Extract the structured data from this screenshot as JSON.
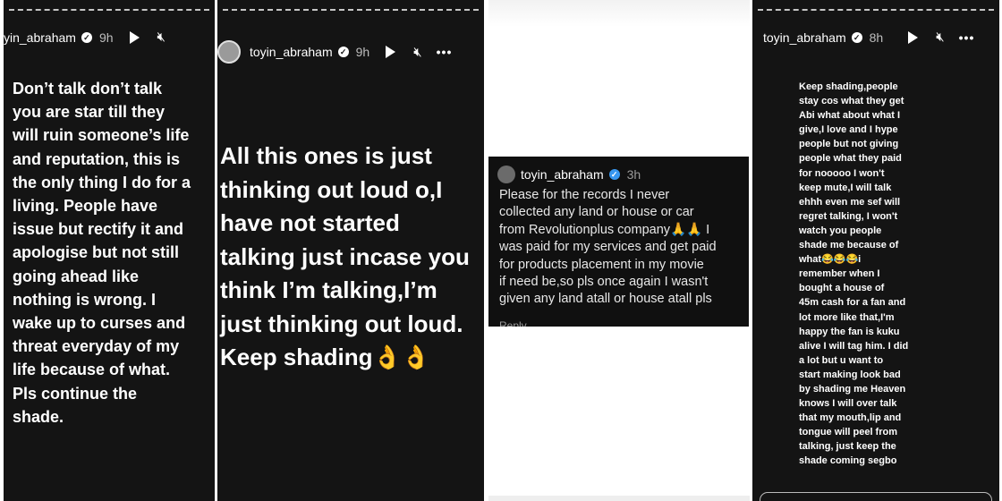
{
  "panels": [
    {
      "username": "yin_abraham",
      "time": "9h",
      "story_text": "Don’t talk don’t talk\nyou are star till they\nwill ruin someone’s life\nand reputation, this is\nthe only thing I do for a\nliving. People have\nissue but rectify it and\napologise but not still\ngoing ahead like\nnothing is wrong. I\nwake up to curses and\nthreat everyday of my\nlife because of what.\nPls continue the\nshade."
    },
    {
      "username": "toyin_abraham",
      "time": "9h",
      "story_text": "All this ones is just\nthinking out loud o,I\nhave not started\ntalking just incase you\nthink I’m talking,I’m\njust thinking out loud.\nKeep shading👌👌"
    },
    {
      "username": "toyin_abraham",
      "time": "3h",
      "post_text": "Please for the records I never\ncollected any land or house or car\nfrom Revolutionplus company🙏🙏 I\nwas paid for my services and get paid\nfor products placement in my movie\nif need be,so pls once again I wasn't\ngiven any land atall or house atall pls",
      "reply_label": "Reply"
    },
    {
      "username": "toyin_abraham",
      "time": "8h",
      "story_text": "Keep shading,people\nstay cos what they get\nAbi what about what I\ngive,I love and I hype\npeople but not giving\npeople what they paid\nfor nooooo I won't\nkeep mute,I will talk\nehhh even me sef will\nregret talking, I won't\nwatch you people\nshade me because of\nwhat😂😂😂i\nremember when I\nbought a house of\n45m cash for a fan and\nlot more like that,I'm\nhappy the fan is kuku\nalive I will tag him. I did\na lot but u want to\nstart making look bad\nby shading me Heaven\nknows I will over talk\nthat my mouth,lip and\ntongue will peel from\ntalking, just keep the\nshade coming segbo"
    }
  ],
  "icons": {
    "verified": "verified-badge-icon",
    "play": "play-icon",
    "mute": "mute-icon",
    "more": "more-options-icon"
  },
  "colors": {
    "story_bg": "#141414",
    "verified_blue": "#3897f0",
    "text": "#ffffff"
  }
}
